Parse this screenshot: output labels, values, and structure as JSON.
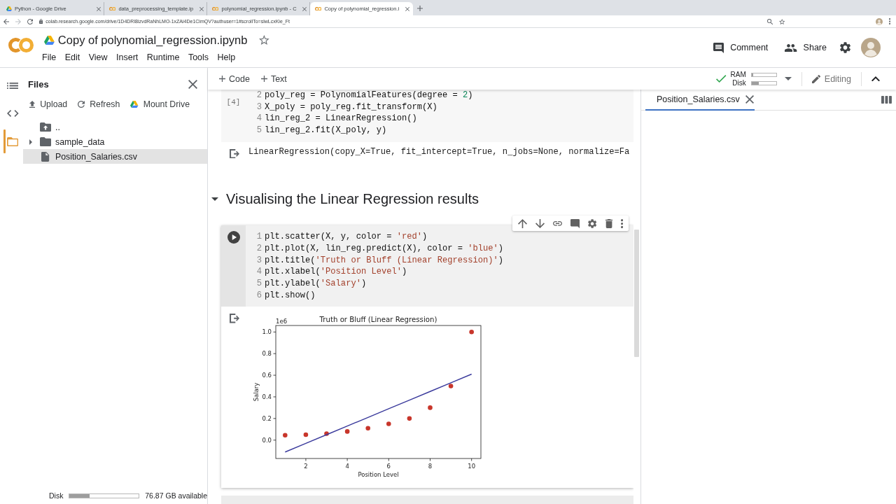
{
  "browser": {
    "tabs": [
      {
        "title": "Python - Google Drive",
        "kind": "drive",
        "selected": false
      },
      {
        "title": "data_preprocessing_template.ip",
        "kind": "notebook",
        "selected": false
      },
      {
        "title": "polynomial_regression.ipynb - C",
        "kind": "notebook",
        "selected": false
      },
      {
        "title": "Copy of polynomial_regression.i",
        "kind": "notebook",
        "selected": true
      }
    ],
    "url": "colab.research.google.com/drive/1D4DRl8izvdRaNhLMO-1xZAi4De1CimQV?authuser=1#scrollTo=slwLcxKie_Ft"
  },
  "header": {
    "title": "Copy of polynomial_regression.ipynb",
    "starred": false,
    "menu": [
      "File",
      "Edit",
      "View",
      "Insert",
      "Runtime",
      "Tools",
      "Help"
    ],
    "actions": [
      {
        "label": "Comment",
        "kind": "comment"
      },
      {
        "label": "Share",
        "kind": "share"
      }
    ]
  },
  "rail": [
    {
      "kind": "toc",
      "selected": false
    },
    {
      "kind": "code",
      "selected": false
    },
    {
      "kind": "files",
      "selected": true
    }
  ],
  "files": {
    "title": "Files",
    "actions": [
      {
        "label": "Upload",
        "kind": "upload"
      },
      {
        "label": "Refresh",
        "kind": "refresh"
      },
      {
        "label": "Mount Drive",
        "kind": "drive"
      }
    ],
    "tree": [
      {
        "name": "..",
        "kind": "parent",
        "selected": false
      },
      {
        "name": "sample_data",
        "kind": "folder",
        "expanded": false,
        "selected": false
      },
      {
        "name": "Position_Salaries.csv",
        "kind": "file",
        "selected": true
      }
    ],
    "disk": {
      "label": "Disk",
      "level": 0.29,
      "text": "76.87 GB available"
    }
  },
  "toolbar": {
    "insert": [
      "Code",
      "Text"
    ],
    "connected": true,
    "resources": [
      {
        "label": "RAM",
        "level": 0.05
      },
      {
        "label": "Disk",
        "level": 0.28
      }
    ],
    "mode": "Editing"
  },
  "cells": [
    {
      "kind": "code",
      "selected": false,
      "execution_count": "[4]",
      "lines": [
        {
          "number": "2",
          "code": "poly_reg = PolynomialFeatures(degree = 2)"
        },
        {
          "number": "3",
          "code": "X_poly = poly_reg.fit_transform(X)"
        },
        {
          "number": "4",
          "code": "lin_reg_2 = LinearRegression()"
        },
        {
          "number": "5",
          "code": "lin_reg_2.fit(X_poly, y)"
        }
      ],
      "output": {
        "kind": "text",
        "text": "LinearRegression(copy_X=True, fit_intercept=True, n_jobs=None, normalize=Fa"
      }
    },
    {
      "kind": "heading",
      "text": "Visualising the Linear Regression results",
      "expanded": true
    },
    {
      "kind": "code",
      "selected": true,
      "lines": [
        {
          "number": "1",
          "code": "plt.scatter(X, y, color = 'red')"
        },
        {
          "number": "2",
          "code": "plt.plot(X, lin_reg.predict(X), color = 'blue')"
        },
        {
          "number": "3",
          "code": "plt.title('Truth or Bluff (Linear Regression)')"
        },
        {
          "number": "4",
          "code": "plt.xlabel('Position Level')"
        },
        {
          "number": "5",
          "code": "plt.ylabel('Salary')"
        },
        {
          "number": "6",
          "code": "plt.show()"
        }
      ],
      "output": {
        "kind": "chart",
        "chart_data": {
          "type": "scatter",
          "title": "Truth or Bluff (Linear Regression)",
          "xlabel": "Position Level",
          "ylabel": "Salary",
          "x": [
            1,
            2,
            3,
            4,
            5,
            6,
            7,
            8,
            9,
            10
          ],
          "series": [
            {
              "type": "scatter",
              "color": "#c8362b",
              "values": [
                0.045,
                0.05,
                0.06,
                0.08,
                0.11,
                0.15,
                0.2,
                0.3,
                0.5,
                1.0
              ]
            },
            {
              "type": "line",
              "color": "#3a3a9c",
              "values": [
                -0.11,
                -0.03,
                0.05,
                0.13,
                0.21,
                0.29,
                0.37,
                0.45,
                0.53,
                0.61
              ]
            }
          ],
          "xlim": [
            0.55,
            10.45
          ],
          "ylim": [
            -0.17,
            1.06
          ],
          "xticks": [
            2,
            4,
            6,
            8,
            10
          ],
          "yticks": [
            {
              "value": 0,
              "label": "0.0"
            },
            0.2,
            0.4,
            0.6,
            0.8,
            {
              "value": 1,
              "label": "1.0"
            }
          ],
          "annotations": [
            {
              "text": "1e6"
            }
          ]
        }
      }
    }
  ],
  "viewer": {
    "tabs": [
      {
        "label": "Position_Salaries.csv",
        "selected": true
      }
    ]
  }
}
